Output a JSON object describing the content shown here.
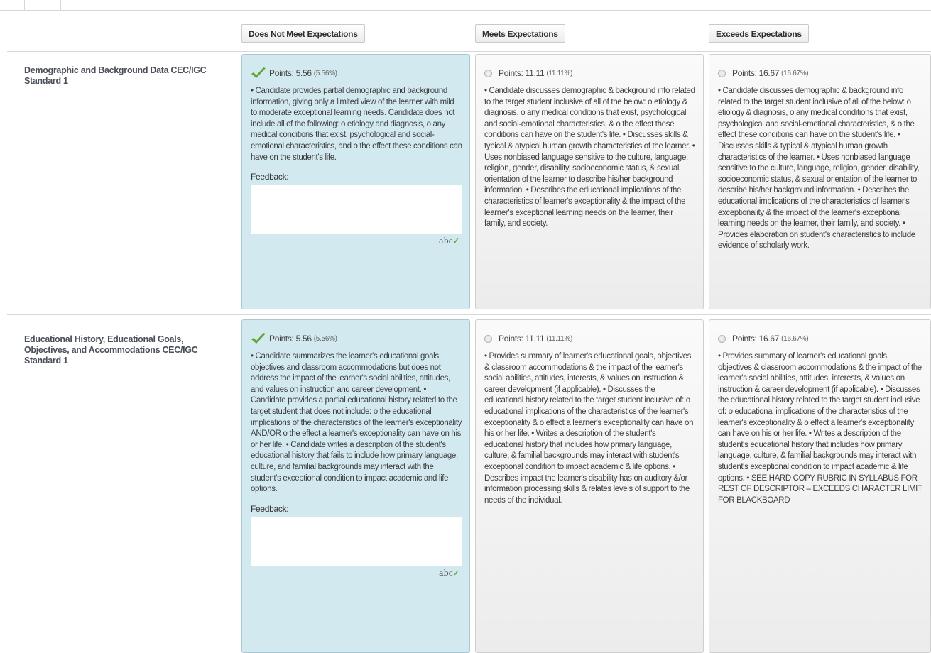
{
  "columns": [
    {
      "label": "Does Not Meet Expectations"
    },
    {
      "label": "Meets Expectations"
    },
    {
      "label": "Exceeds Expectations"
    }
  ],
  "rows": [
    {
      "criterion": "Demographic and Background Data CEC/IGC Standard 1",
      "cells": [
        {
          "points": "Points: 5.56",
          "percent": "(5.56%)",
          "selected": true,
          "description": "• Candidate provides partial demographic and background information, giving only a limited view of the learner with mild to moderate exceptional learning needs. Candidate does not include all of the following: o etiology and diagnosis, o any medical conditions that exist, psychological and social-emotional characteristics, and o the effect these conditions can have on the student's life.",
          "feedback_label": "Feedback:",
          "feedback_value": ""
        },
        {
          "points": "Points: 11.11",
          "percent": "(11.11%)",
          "selected": false,
          "description": "• Candidate discusses demographic & background info related to the target student inclusive of all of the below: o etiology & diagnosis, o any medical conditions that exist, psychological and social-emotional characteristics, & o the effect these conditions can have on the student's life. • Discusses skills & typical & atypical human growth characteristics of the learner. • Uses nonbiased language sensitive to the culture, language, religion, gender, disability, socioeconomic status, & sexual orientation of the learner to describe his/her background information. • Describes the educational implications of the characteristics of learner's exceptionality & the impact of the learner's exceptional learning needs on the learner, their family, and society."
        },
        {
          "points": "Points: 16.67",
          "percent": "(16.67%)",
          "selected": false,
          "description": "• Candidate discusses demographic & background info related to the target student inclusive of all of the below: o etiology & diagnosis, o any medical conditions that exist, psychological and social-emotional characteristics, & o the effect these conditions can have on the student's life. • Discusses skills & typical & atypical human growth characteristics of the learner. • Uses nonbiased language sensitive to the culture, language, religion, gender, disability, socioeconomic status, & sexual orientation of the learner to describe his/her background information. • Describes the educational implications of the characteristics of learner's exceptionality & the impact of the learner's exceptional learning needs on the learner, their family, and society. • Provides elaboration on student's characteristics to include evidence of scholarly work."
        }
      ]
    },
    {
      "criterion": "Educational History, Educational Goals, Objectives, and Accommodations CEC/IGC Standard 1",
      "cells": [
        {
          "points": "Points: 5.56",
          "percent": "(5.56%)",
          "selected": true,
          "description": "• Candidate summarizes the learner's educational goals, objectives and classroom accommodations but does not address the impact of the learner's social abilities, attitudes, and values on instruction and career development. • Candidate provides a partial educational history related to the target student that does not include: o the educational implications of the characteristics of the learner's exceptionality AND/OR o the effect a learner's exceptionality can have on his or her life. • Candidate writes a description of the student's educational history that fails to include how primary language, culture, and familial backgrounds may interact with the student's exceptional condition to impact academic and life options.",
          "feedback_label": "Feedback:",
          "feedback_value": ""
        },
        {
          "points": "Points: 11.11",
          "percent": "(11.11%)",
          "selected": false,
          "description": "• Provides summary of learner's educational goals, objectives & classroom accommodations & the impact of the learner's social abilities, attitudes, interests, & values on instruction & career development (if applicable). • Discusses the educational history related to the target student inclusive of: o educational implications of the characteristics of the learner's exceptionality & o effect a learner's exceptionality can have on his or her life. • Writes a description of the student's educational history that includes how primary language, culture, & familial backgrounds may interact with student's exceptional condition to impact academic & life options. • Describes impact the learner's disability has on auditory &/or information processing skills & relates levels of support to the needs of the individual."
        },
        {
          "points": "Points: 16.67",
          "percent": "(16.67%)",
          "selected": false,
          "description": "• Provides summary of learner's educational goals, objectives & classroom accommodations & the impact of the learner's social abilities, attitudes, interests, & values on instruction & career development (if applicable). • Discusses the educational history related to the target student inclusive of: o educational implications of the characteristics of the learner's exceptionality & o effect a learner's exceptionality can have on his or her life. • Writes a description of the student's educational history that includes how primary language, culture, & familial backgrounds may interact with student's exceptional condition to impact academic & life options. • SEE HARD COPY RUBRIC IN SYLLABUS FOR REST OF DESCRIPTOR – EXCEEDS CHARACTER LIMIT FOR BLACKBOARD"
        }
      ]
    }
  ],
  "spellcheck_label": "abc",
  "colors": {
    "selected_bg": "#d3e9f0",
    "check_green": "#5fa733"
  },
  "icons": {
    "selected": "checkmark-icon",
    "unselected": "radio-icon",
    "spellcheck": "spellcheck-icon"
  }
}
